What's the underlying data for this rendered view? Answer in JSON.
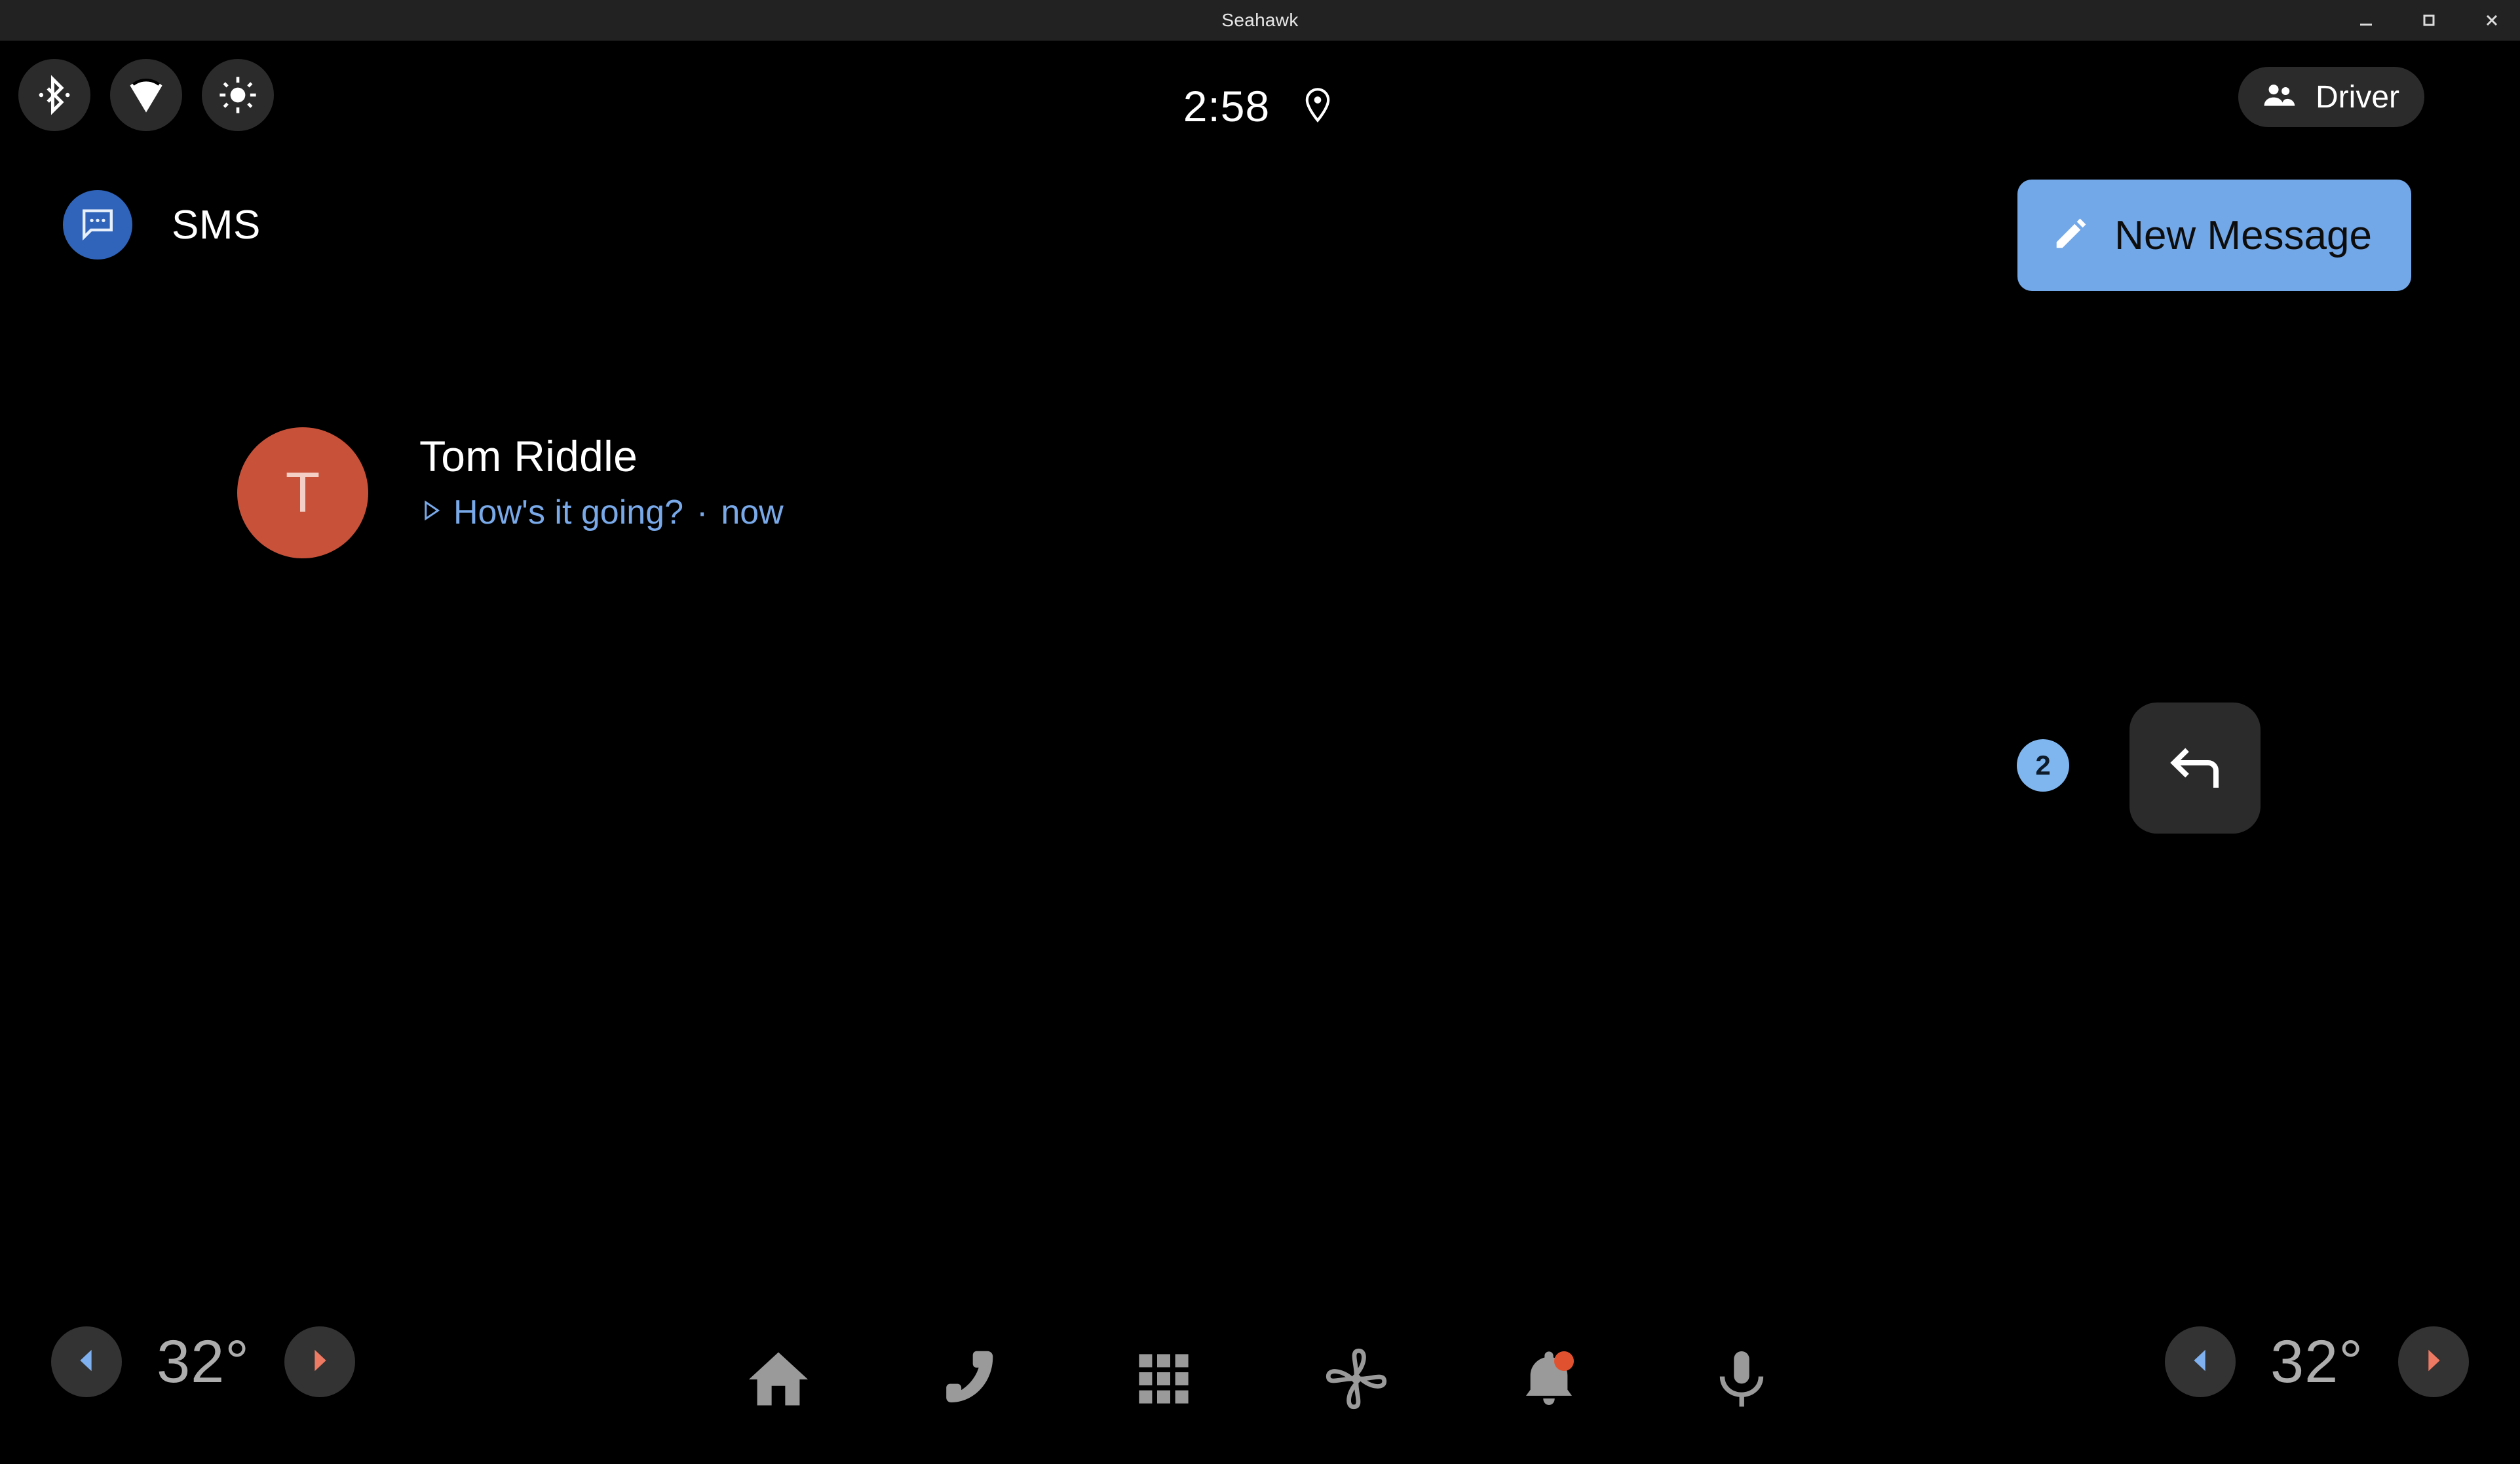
{
  "window": {
    "title": "Seahawk",
    "controls": [
      {
        "name": "minimize",
        "label": "Minimize"
      },
      {
        "name": "maximize",
        "label": "Maximize"
      },
      {
        "name": "close",
        "label": "Close"
      }
    ]
  },
  "status_bar": {
    "system_icons": [
      {
        "name": "bluetooth-icon",
        "label": "Bluetooth"
      },
      {
        "name": "wifi-icon",
        "label": "Wi-Fi"
      },
      {
        "name": "brightness-icon",
        "label": "Brightness"
      }
    ],
    "clock": "2:58",
    "location_icon": "location-pin-icon",
    "profile": {
      "label": "Driver",
      "icon": "people-icon"
    }
  },
  "app": {
    "title": "SMS",
    "icon": "message-bubble-icon",
    "new_message": {
      "label": "New Message",
      "icon": "pencil-icon"
    }
  },
  "conversations": [
    {
      "avatar_letter": "T",
      "avatar_color": "#c85139",
      "name": "Tom Riddle",
      "preview": "How's it going?",
      "separator": "·",
      "time": "now",
      "play_icon": "play-triangle-icon",
      "unread_count": "2",
      "reply_icon": "reply-arrow-icon"
    }
  ],
  "nav_bar": {
    "climate_left": {
      "decrease_icon": "triangle-left-icon",
      "temperature": "32°",
      "increase_icon": "triangle-right-icon"
    },
    "climate_right": {
      "decrease_icon": "triangle-left-icon",
      "temperature": "32°",
      "increase_icon": "triangle-right-icon"
    },
    "items": [
      {
        "name": "home-icon",
        "label": "Home"
      },
      {
        "name": "phone-icon",
        "label": "Phone"
      },
      {
        "name": "apps-grid-icon",
        "label": "Apps"
      },
      {
        "name": "fan-icon",
        "label": "Climate"
      },
      {
        "name": "bell-icon",
        "label": "Notifications",
        "badge": true
      },
      {
        "name": "microphone-icon",
        "label": "Assistant"
      }
    ]
  },
  "colors": {
    "accent_blue": "#72A7E8",
    "app_icon_blue": "#2f64ba",
    "badge_blue": "#7fb6f0",
    "avatar_red": "#c85139",
    "notification_red": "#e0522f",
    "pill_gray": "#2b2b2b",
    "nav_icon_gray": "#9a9a9a",
    "background": "#000000",
    "titlebar": "#222222"
  }
}
